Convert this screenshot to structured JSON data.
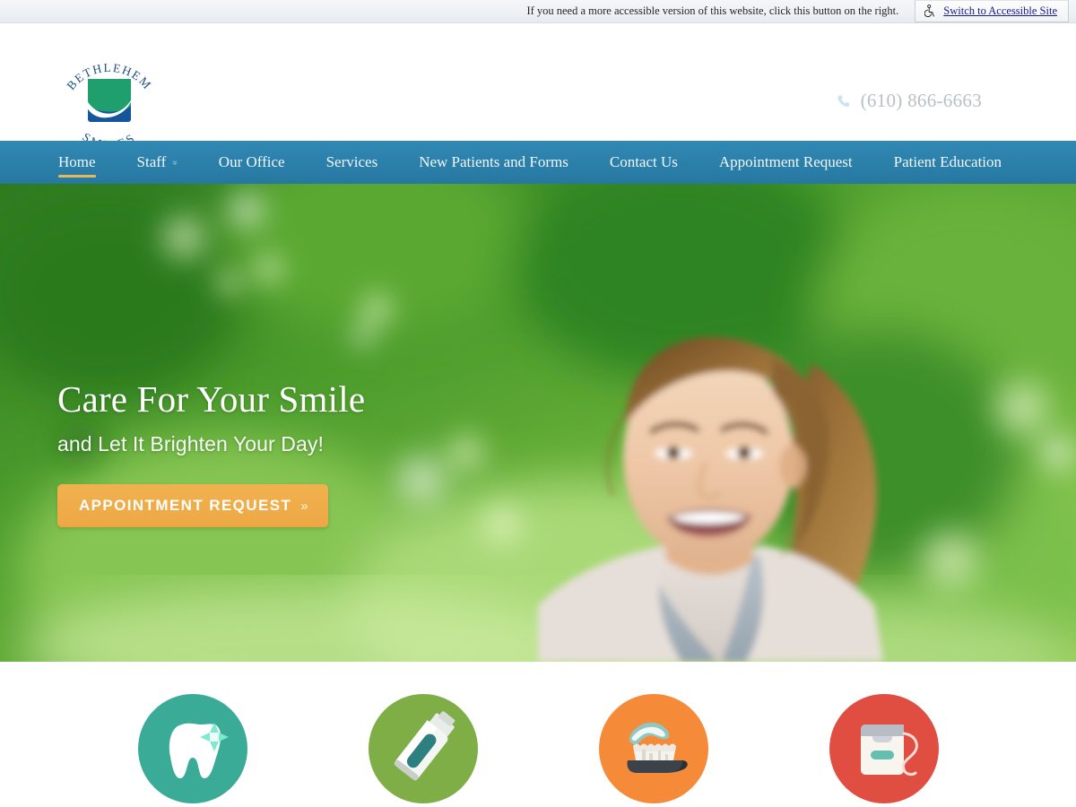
{
  "accessibility_bar": {
    "note": "If you need a more accessible version of this website, click this button on the right.",
    "button_label": "Switch to Accessible Site",
    "icon": "wheelchair-accessibility-icon"
  },
  "header": {
    "logo": {
      "top_text": "BETHLEHEM",
      "bottom_text": "SMILES",
      "mark": "smile-curve-square",
      "green": "#1f9e6e",
      "blue": "#14559b",
      "text_color": "#1f4f82"
    },
    "phone": {
      "icon": "phone-icon",
      "number": "(610) 866-6663",
      "color": "#b9bfc4"
    }
  },
  "nav": {
    "background": "#2b80aa",
    "active_underline": "#e5b85c",
    "items": [
      {
        "label": "Home",
        "active": true,
        "has_dropdown": false
      },
      {
        "label": "Staff",
        "active": false,
        "has_dropdown": true
      },
      {
        "label": "Our Office",
        "active": false,
        "has_dropdown": false
      },
      {
        "label": "Services",
        "active": false,
        "has_dropdown": false
      },
      {
        "label": "New Patients and Forms",
        "active": false,
        "has_dropdown": false
      },
      {
        "label": "Contact Us",
        "active": false,
        "has_dropdown": false
      },
      {
        "label": "Appointment Request",
        "active": false,
        "has_dropdown": false
      },
      {
        "label": "Patient Education",
        "active": false,
        "has_dropdown": false
      }
    ],
    "chevron_glyph": "»"
  },
  "hero": {
    "title": "Care For Your Smile",
    "subtitle": "and Let It Brighten Your Day!",
    "cta_label": "APPOINTMENT REQUEST",
    "cta_arrow": "»",
    "cta_color": "#eda844",
    "photo_description": "smiling-woman-outdoors-green-bokeh",
    "background_color": "#3f8f2e"
  },
  "services": [
    {
      "name": "tooth-sparkle-icon",
      "circle_color": "#3aab96",
      "accent_color": "#7fe8cf"
    },
    {
      "name": "toothpaste-tube-icon",
      "circle_color": "#7fae46",
      "accent_color": "#2d7f80"
    },
    {
      "name": "toothbrush-paste-icon",
      "circle_color": "#f58b38",
      "accent_color": "#8fc7c3"
    },
    {
      "name": "dental-floss-icon",
      "circle_color": "#e04e42",
      "accent_color": "#64bfb0"
    }
  ]
}
